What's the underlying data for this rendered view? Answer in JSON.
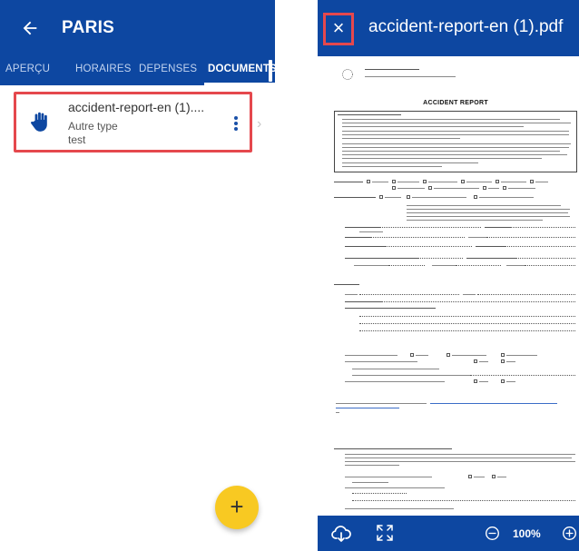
{
  "left": {
    "title": "PARIS",
    "tabs": [
      "APERÇU",
      "HORAIRES",
      "DEPENSES",
      "DOCUMENTS"
    ],
    "active_tab": "DOCUMENTS",
    "document": {
      "name": "accident-report-en (1)....",
      "type": "Autre type",
      "description": "test",
      "icon": "hand-icon"
    },
    "fab_label": "+"
  },
  "right": {
    "title": "accident-report-en (1).pdf",
    "close_label": "×",
    "preview": {
      "heading": "ACCIDENT REPORT"
    },
    "footer": {
      "zoom": "100%"
    }
  },
  "colors": {
    "header_blue": "#0d47a1",
    "highlight_red": "#e5484d",
    "fab_yellow": "#f8c922"
  }
}
